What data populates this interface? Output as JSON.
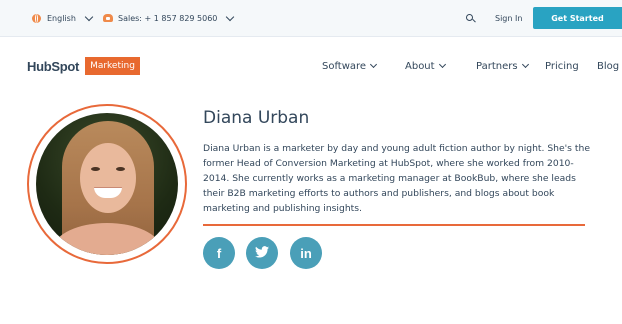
{
  "topbar": {
    "language": "English",
    "sales": "Sales: + 1 857 829 5060",
    "sign_in": "Sign In",
    "get_started": "Get Started"
  },
  "nav": {
    "logo_text": "HubSpot",
    "logo_badge": "Marketing",
    "items": [
      {
        "label": "Software",
        "has_dropdown": true
      },
      {
        "label": "About",
        "has_dropdown": true
      },
      {
        "label": "Partners",
        "has_dropdown": true
      },
      {
        "label": "Pricing",
        "has_dropdown": false
      },
      {
        "label": "Blog",
        "has_dropdown": false
      }
    ]
  },
  "author": {
    "name": "Diana Urban",
    "bio": "Diana Urban is a marketer by day and young adult fiction author by night. She's the former Head of Conversion Marketing at HubSpot, where she worked from 2010-2014. She currently works as a marketing manager at BookBub, where she leads their B2B marketing efforts to authors and publishers, and blogs about book marketing and publishing insights."
  },
  "social": [
    {
      "icon": "facebook-icon",
      "glyph": "f"
    },
    {
      "icon": "twitter-icon",
      "glyph": "t"
    },
    {
      "icon": "linkedin-icon",
      "glyph": "in"
    }
  ],
  "colors": {
    "accent": "#e8693a",
    "button": "#29a3c2",
    "social": "#4a9fb8",
    "text": "#33475b"
  }
}
